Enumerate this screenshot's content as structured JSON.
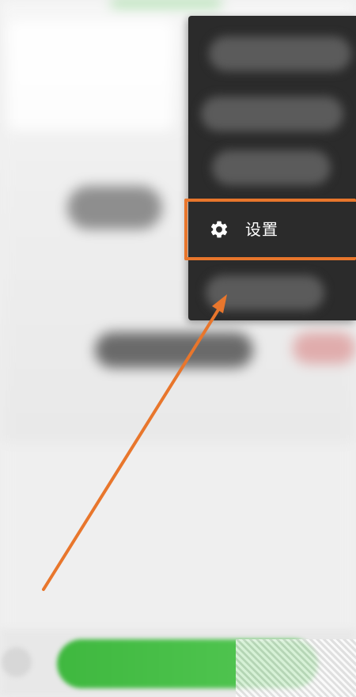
{
  "menu": {
    "settings_label": "设置",
    "settings_icon": "gear-icon"
  },
  "annotation": {
    "highlight_color": "#e8762c",
    "arrow_color": "#e8762c"
  }
}
